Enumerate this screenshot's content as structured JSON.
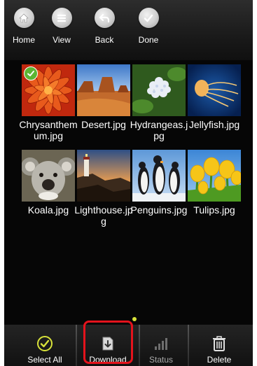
{
  "toolbar": {
    "items": [
      {
        "label": "Home",
        "icon": "home-icon"
      },
      {
        "label": "View",
        "icon": "list-icon"
      },
      {
        "label": "Back",
        "icon": "back-arrow-icon"
      },
      {
        "label": "Done",
        "icon": "checkmark-icon"
      }
    ]
  },
  "files": [
    {
      "name": "Chrysanthemum.jpg",
      "selected": true
    },
    {
      "name": "Desert.jpg",
      "selected": false
    },
    {
      "name": "Hydrangeas.jpg",
      "selected": false
    },
    {
      "name": "Jellyfish.jpg",
      "selected": false
    },
    {
      "name": "Koala.jpg",
      "selected": false
    },
    {
      "name": "Lighthouse.jpg",
      "selected": false
    },
    {
      "name": "Penguins.jpg",
      "selected": false
    },
    {
      "name": "Tulips.jpg",
      "selected": false
    }
  ],
  "bottom_bar": {
    "select_all": "Select All",
    "download": "Download",
    "status": "Status",
    "delete": "Delete"
  },
  "colors": {
    "highlight": "#e4131c",
    "check_green": "#5cb634",
    "select_all_icon": "#d8e23a"
  }
}
